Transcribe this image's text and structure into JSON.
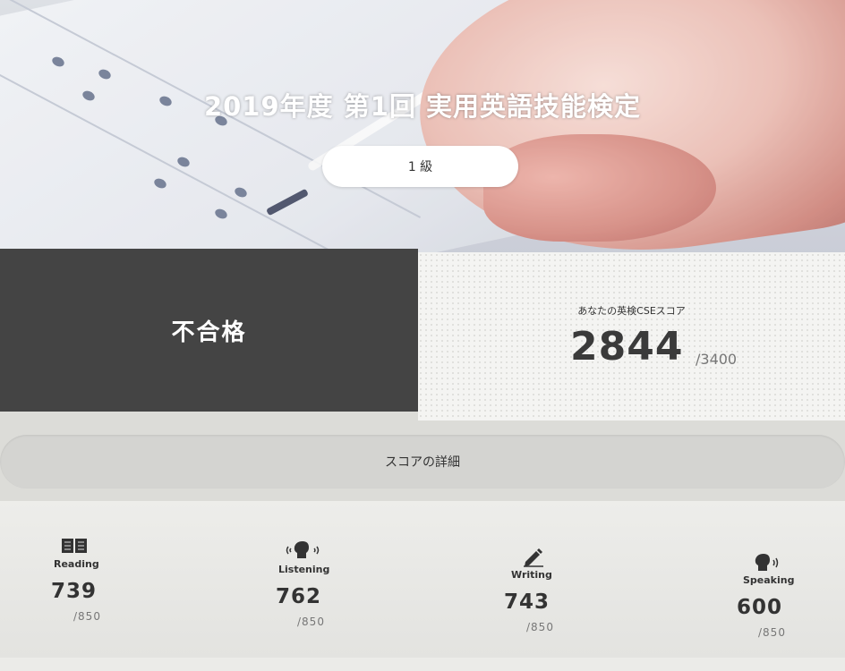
{
  "header": {
    "title": "2019年度 第1回 実用英語技能検定",
    "grade": "1 級"
  },
  "result": {
    "status": "不合格",
    "cse_label": "あなたの英検CSEスコア",
    "cse_score": "2844",
    "cse_max": "/3400"
  },
  "detail_button": "スコアの詳細",
  "skills": [
    {
      "label": "Reading",
      "score": "739",
      "max": "/850",
      "icon": "book-icon"
    },
    {
      "label": "Listening",
      "score": "762",
      "max": "/850",
      "icon": "listening-head-icon"
    },
    {
      "label": "Writing",
      "score": "743",
      "max": "/850",
      "icon": "pencil-icon"
    },
    {
      "label": "Speaking",
      "score": "600",
      "max": "/850",
      "icon": "speaking-head-icon"
    }
  ],
  "colors": {
    "result_bg": "#444444",
    "text": "#333333",
    "muted": "#777777"
  }
}
